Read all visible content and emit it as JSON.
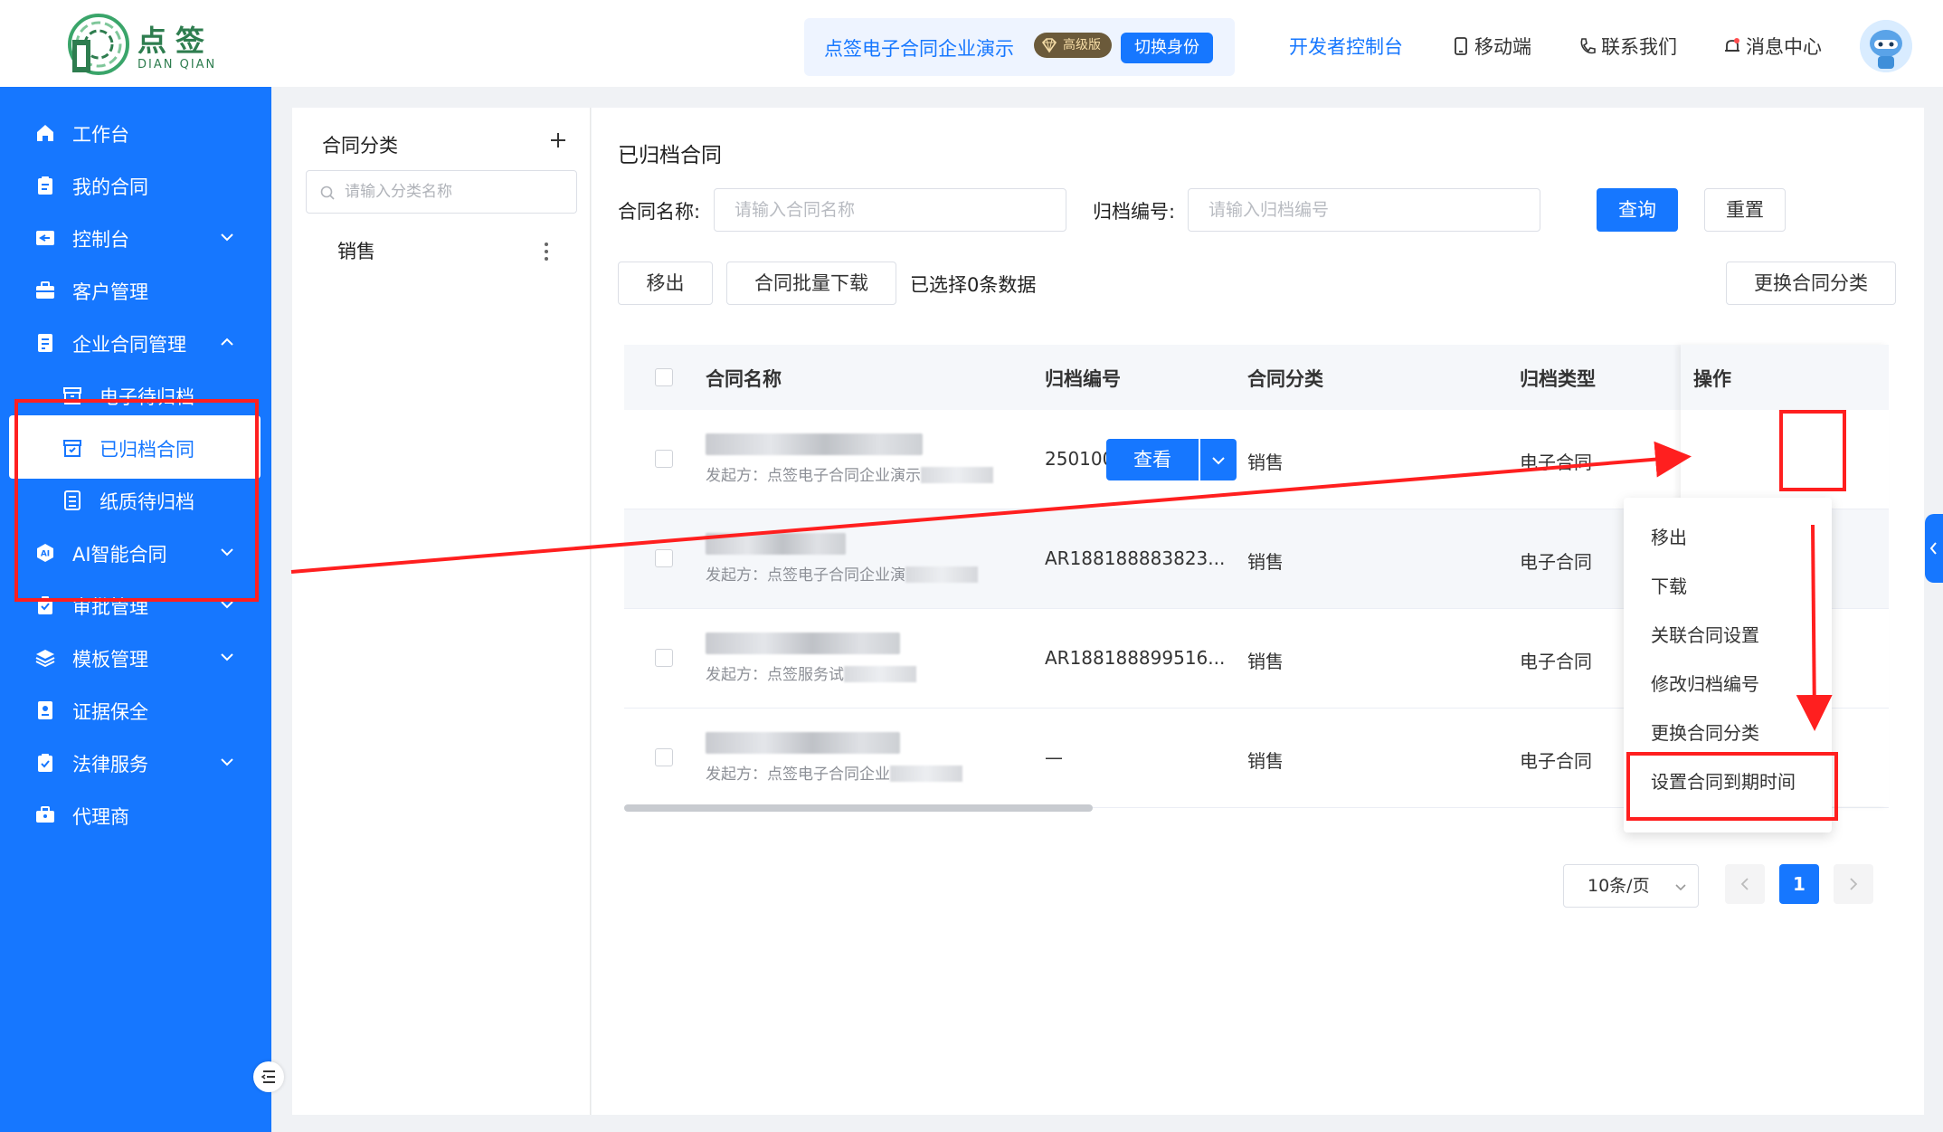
{
  "header": {
    "logo_cn": "点签",
    "logo_en": "DIAN QIAN",
    "company_name": "点签电子合同企业演示",
    "vip_badge": "高级版",
    "switch_identity": "切换身份",
    "nav": {
      "developer": "开发者控制台",
      "mobile": "移动端",
      "contact": "联系我们",
      "messages": "消息中心"
    }
  },
  "sidebar": {
    "items": [
      {
        "label": "工作台",
        "icon": "home-icon"
      },
      {
        "label": "我的合同",
        "icon": "clipboard-icon"
      },
      {
        "label": "控制台",
        "icon": "console-icon",
        "expandable": true
      },
      {
        "label": "客户管理",
        "icon": "briefcase-icon"
      },
      {
        "label": "企业合同管理",
        "icon": "document-icon",
        "expanded": true
      },
      {
        "label": "电子待归档",
        "icon": "archive-box-icon",
        "sub": true
      },
      {
        "label": "已归档合同",
        "icon": "archived-icon",
        "sub": true,
        "active": true
      },
      {
        "label": "纸质待归档",
        "icon": "paper-doc-icon",
        "sub": true
      },
      {
        "label": "AI智能合同",
        "icon": "ai-icon",
        "expandable": true
      },
      {
        "label": "审批管理",
        "icon": "approval-icon",
        "expandable": true
      },
      {
        "label": "模板管理",
        "icon": "layers-icon",
        "expandable": true
      },
      {
        "label": "证据保全",
        "icon": "evidence-icon"
      },
      {
        "label": "法律服务",
        "icon": "legal-icon",
        "expandable": true
      },
      {
        "label": "代理商",
        "icon": "agent-icon"
      }
    ]
  },
  "category_panel": {
    "title": "合同分类",
    "search_placeholder": "请输入分类名称",
    "items": [
      "销售"
    ]
  },
  "main": {
    "title": "已归档合同",
    "filters": {
      "name_label": "合同名称:",
      "name_placeholder": "请输入合同名称",
      "number_label": "归档编号:",
      "number_placeholder": "请输入归档编号",
      "query": "查询",
      "reset": "重置"
    },
    "actions": {
      "move_out": "移出",
      "batch_download": "合同批量下载",
      "selected": "已选择0条数据",
      "change_category": "更换合同分类"
    },
    "table": {
      "columns": [
        "合同名称",
        "归档编号",
        "合同分类",
        "归档类型",
        "操作"
      ],
      "rows": [
        {
          "initiator": "发起方：点签电子合同企业演示",
          "number": "2501001",
          "category": "销售",
          "type": "电子合同"
        },
        {
          "initiator": "发起方：点签电子合同企业演",
          "number": "AR188188883823...",
          "category": "销售",
          "type": "电子合同"
        },
        {
          "initiator": "发起方：点签服务试",
          "number": "AR188188899516...",
          "category": "销售",
          "type": "电子合同"
        },
        {
          "initiator": "发起方：点签电子合同企业",
          "number": "—",
          "category": "销售",
          "type": "电子合同"
        }
      ],
      "view_button": "查看"
    },
    "dropdown": [
      "移出",
      "下载",
      "关联合同设置",
      "修改归档编号",
      "更换合同分类",
      "设置合同到期时间"
    ],
    "pagination": {
      "page_size": "10条/页",
      "current": "1"
    }
  },
  "colors": {
    "primary": "#1677ff",
    "annotation": "#ff1f1f",
    "logo_green": "#2e7d4f"
  }
}
